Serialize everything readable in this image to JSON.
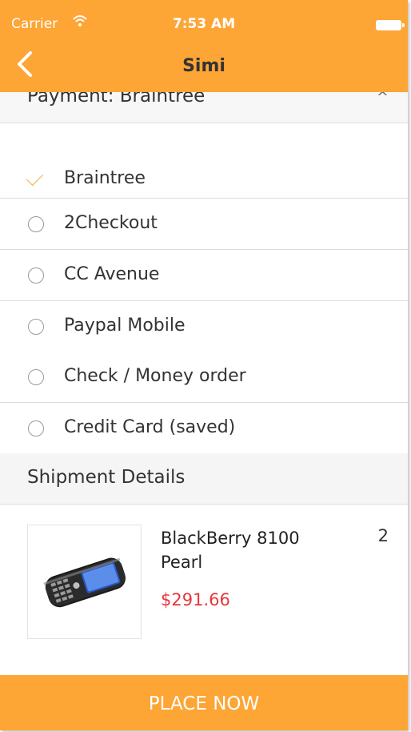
{
  "status_bar": {
    "carrier": "Carrier",
    "time": "7:53 AM"
  },
  "nav": {
    "title": "Simi"
  },
  "payment": {
    "header": "Payment: Braintree",
    "selected": "Braintree",
    "options": [
      "2Checkout",
      "CC Avenue",
      "Paypal Mobile",
      "Check / Money order",
      "Credit Card (saved)"
    ]
  },
  "shipment": {
    "header": "Shipment Details",
    "item": {
      "name": "BlackBerry 8100 Pearl",
      "quantity": "2",
      "price": "$291.66"
    }
  },
  "footer": {
    "place_label": "PLACE NOW"
  },
  "colors": {
    "accent": "#FDA535",
    "price": "#e8363d"
  },
  "icons": [
    "wifi-icon",
    "battery-icon",
    "back-chevron-icon",
    "collapse-chevron-icon",
    "checkmark-icon",
    "radio-icon",
    "product-image"
  ]
}
